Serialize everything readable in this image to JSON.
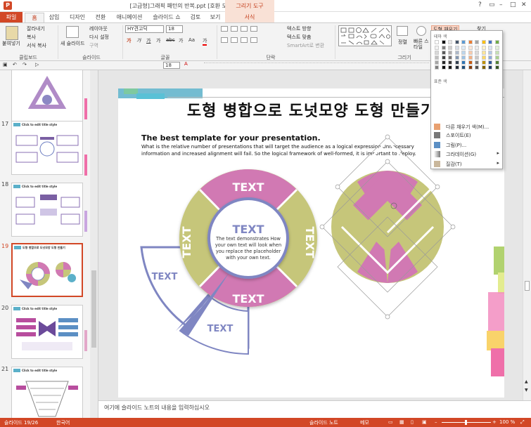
{
  "window": {
    "title": "[고급형]그래픽 패턴의 반복.ppt [호환 모드] - PowerPoint",
    "context_tool": "그리기 도구",
    "controls": [
      "?",
      "▭",
      "–",
      "□",
      "✕"
    ]
  },
  "tabs": [
    "파일",
    "홈",
    "삽입",
    "디자인",
    "전환",
    "애니메이션",
    "슬라이드 쇼",
    "검토",
    "보기",
    "서식"
  ],
  "ribbon": {
    "clipboard": {
      "paste": "붙여넣기",
      "cut": "잘라내기",
      "copy": "복사",
      "format_painter": "서식 복사",
      "label": "클립보드"
    },
    "slides": {
      "new_slide": "새 슬라이드",
      "layout": "레이아웃",
      "reset": "다시 설정",
      "section": "구역",
      "label": "슬라이드"
    },
    "font": {
      "name": "HY견고딕",
      "size": "18",
      "label": "글꼴",
      "buttons": [
        "가",
        "가",
        "가",
        "가",
        "abc",
        "가",
        "Aa",
        "가"
      ]
    },
    "paragraph": {
      "text_direction": "텍스트 방향",
      "align_text": "텍스트 맞춤",
      "smartart": "SmartArt로 변환",
      "label": "단락"
    },
    "drawing": {
      "arrange": "정렬",
      "quick_styles": "빠른 스타일",
      "shape_fill": "도형 채우기",
      "label": "그리기"
    },
    "editing": {
      "find": "찾기"
    }
  },
  "qat": {
    "font_size": "18"
  },
  "dropdown": {
    "theme_colors": "테마 색",
    "standard_colors": "표준 색",
    "theme_rows": [
      [
        "#ffffff",
        "#000000",
        "#e7e6e6",
        "#44546a",
        "#5b9bd5",
        "#ed7d31",
        "#a5a5a5",
        "#ffc000",
        "#4472c4",
        "#70ad47"
      ],
      [
        "#f2f2f2",
        "#7f7f7f",
        "#d0cece",
        "#d6dce5",
        "#deebf7",
        "#fbe5d6",
        "#ededed",
        "#fff2cc",
        "#dae3f3",
        "#e2f0d9"
      ],
      [
        "#d9d9d9",
        "#595959",
        "#aeabab",
        "#adb9ca",
        "#bdd7ee",
        "#f8cbad",
        "#dbdbdb",
        "#ffe699",
        "#b4c7e7",
        "#c5e0b4"
      ],
      [
        "#bfbfbf",
        "#404040",
        "#757171",
        "#8497b0",
        "#9dc3e6",
        "#f4b183",
        "#c9c9c9",
        "#ffd966",
        "#8faadc",
        "#a9d18e"
      ],
      [
        "#a6a6a6",
        "#262626",
        "#3a3838",
        "#333f50",
        "#2e75b6",
        "#c55a11",
        "#7b7b7b",
        "#bf9000",
        "#2f5597",
        "#538135"
      ],
      [
        "#7f7f7f",
        "#0d0d0d",
        "#171616",
        "#222a35",
        "#1f4e79",
        "#843c0c",
        "#525252",
        "#7f6000",
        "#203864",
        "#375623"
      ]
    ],
    "items": [
      {
        "label": "다른 채우기 색(M)...",
        "icon": "palette-icon"
      },
      {
        "label": "스포이트(E)",
        "icon": "eyedropper-icon"
      },
      {
        "label": "그림(P)...",
        "icon": "picture-icon"
      },
      {
        "label": "그라데이션(G)",
        "icon": "gradient-icon",
        "submenu": true
      },
      {
        "label": "질감(T)",
        "icon": "texture-icon",
        "submenu": true
      }
    ]
  },
  "thumbnails": [
    {
      "num": "17",
      "title": "Click to edit title style"
    },
    {
      "num": "18",
      "title": "Click to edit title style"
    },
    {
      "num": "19",
      "title": "도형 병합으로 도넛모양 도형 만들기",
      "selected": true
    },
    {
      "num": "20",
      "title": "Click to edit title style"
    },
    {
      "num": "21",
      "title": "Click to edit title style"
    }
  ],
  "slide": {
    "title": "도형 병합으로 도넛모양 도형 만들기",
    "subtitle": "The best template for your presentation.",
    "body": "What is the relative number of presentations that will target the audience as a logical expression Unnecessary information and increased alignment will fail. So the logical framework of well-formed, it is important to deploy.",
    "center_title": "TEXT",
    "center_body": "The text demonstrates How your own text will look when you replace the placeholder with your own text.",
    "segments": [
      "TEXT",
      "TEXT",
      "TEXT",
      "TEXT"
    ],
    "outer_labels": [
      "TEXT",
      "TEXT",
      "TEXT"
    ],
    "colors": {
      "pink": "#d179b3",
      "olive": "#c6c67a",
      "blue": "#7f86c2",
      "teal": "#5bb0c9"
    }
  },
  "notes": "여기에 슬라이드 노트의 내용을 입력하십시오",
  "status": {
    "slide_info": "슬라이드 19/26",
    "language": "한국어",
    "notes": "슬라이드 노트",
    "memo": "메모",
    "zoom": "100 %"
  }
}
